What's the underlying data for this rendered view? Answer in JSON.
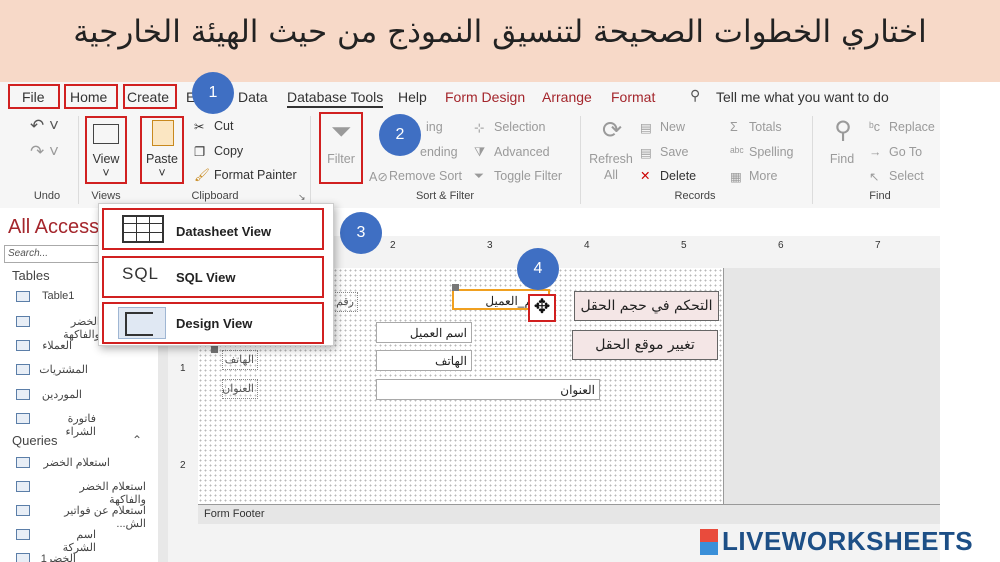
{
  "banner": {
    "title": "اختاري الخطوات الصحيحة لتنسيق النموذج من حيث الهيئة الخارجية"
  },
  "menu": [
    "File",
    "Home",
    "Create",
    "E",
    "Data",
    "Database Tools",
    "Help",
    "Form Design",
    "Arrange",
    "Format"
  ],
  "tell_me": "Tell me what you want to do",
  "ribbon": {
    "undo": "Undo",
    "views_group": "Views",
    "view": "View",
    "paste": "Paste",
    "cut": "Cut",
    "copy": "Copy",
    "format_painter": "Format Painter",
    "clipboard": "Clipboard",
    "filter": "Filter",
    "ascending": "ing",
    "descending": "ending",
    "remove_sort": "Remove Sort",
    "selection": "Selection",
    "advanced": "Advanced",
    "toggle_filter": "Toggle Filter",
    "sort_filter": "Sort & Filter",
    "refresh": "Refresh",
    "refresh_all": "All",
    "new": "New",
    "save": "Save",
    "delete": "Delete",
    "totals": "Totals",
    "spelling": "Spelling",
    "more": "More",
    "records": "Records",
    "find": "Find",
    "replace": "Replace",
    "goto": "Go To",
    "select": "Select",
    "find_group": "Find"
  },
  "badges": [
    "1",
    "2",
    "3",
    "4"
  ],
  "nav": {
    "title": "All Access",
    "search": "Search...",
    "tables_header": "Tables",
    "tables": [
      "Table1",
      "الخضر والفاكهة",
      "العملاء",
      "المشتريات",
      "الموردين",
      "فاتورة الشراء"
    ],
    "queries_header": "Queries",
    "queries": [
      "استعلام الخضر",
      "استعلام الخضر والفاكهة",
      "استعلام عن فواتير الش...",
      "اسم الشركة",
      "الخضر1"
    ]
  },
  "views_menu": [
    "Datasheet View",
    "SQL View",
    "Design View"
  ],
  "sql_glyph": "SQL",
  "form": {
    "label_customer_no": "رقم",
    "field_customer_no": "رقم_العميل",
    "field_customer_name": "اسم العميل",
    "label_phone": "الهاتف",
    "field_phone": "الهاتف",
    "label_address": "العنوان",
    "field_address": "العنوان",
    "form_footer": "Form Footer",
    "ruler_h": [
      "2",
      "3",
      "4",
      "5",
      "6",
      "7"
    ],
    "ruler_v": [
      "1",
      "2"
    ]
  },
  "callouts": {
    "resize": "التحكم في حجم الحقل",
    "move": "تغيير موقع الحقل"
  },
  "brand": "LIVEWORKSHEETS",
  "colors": {
    "badge": "#3f6fc3",
    "highlight": "#d12020",
    "banner": "#f7d9c8",
    "menu_dark": "#a4262c",
    "selection": "#f0a020"
  }
}
